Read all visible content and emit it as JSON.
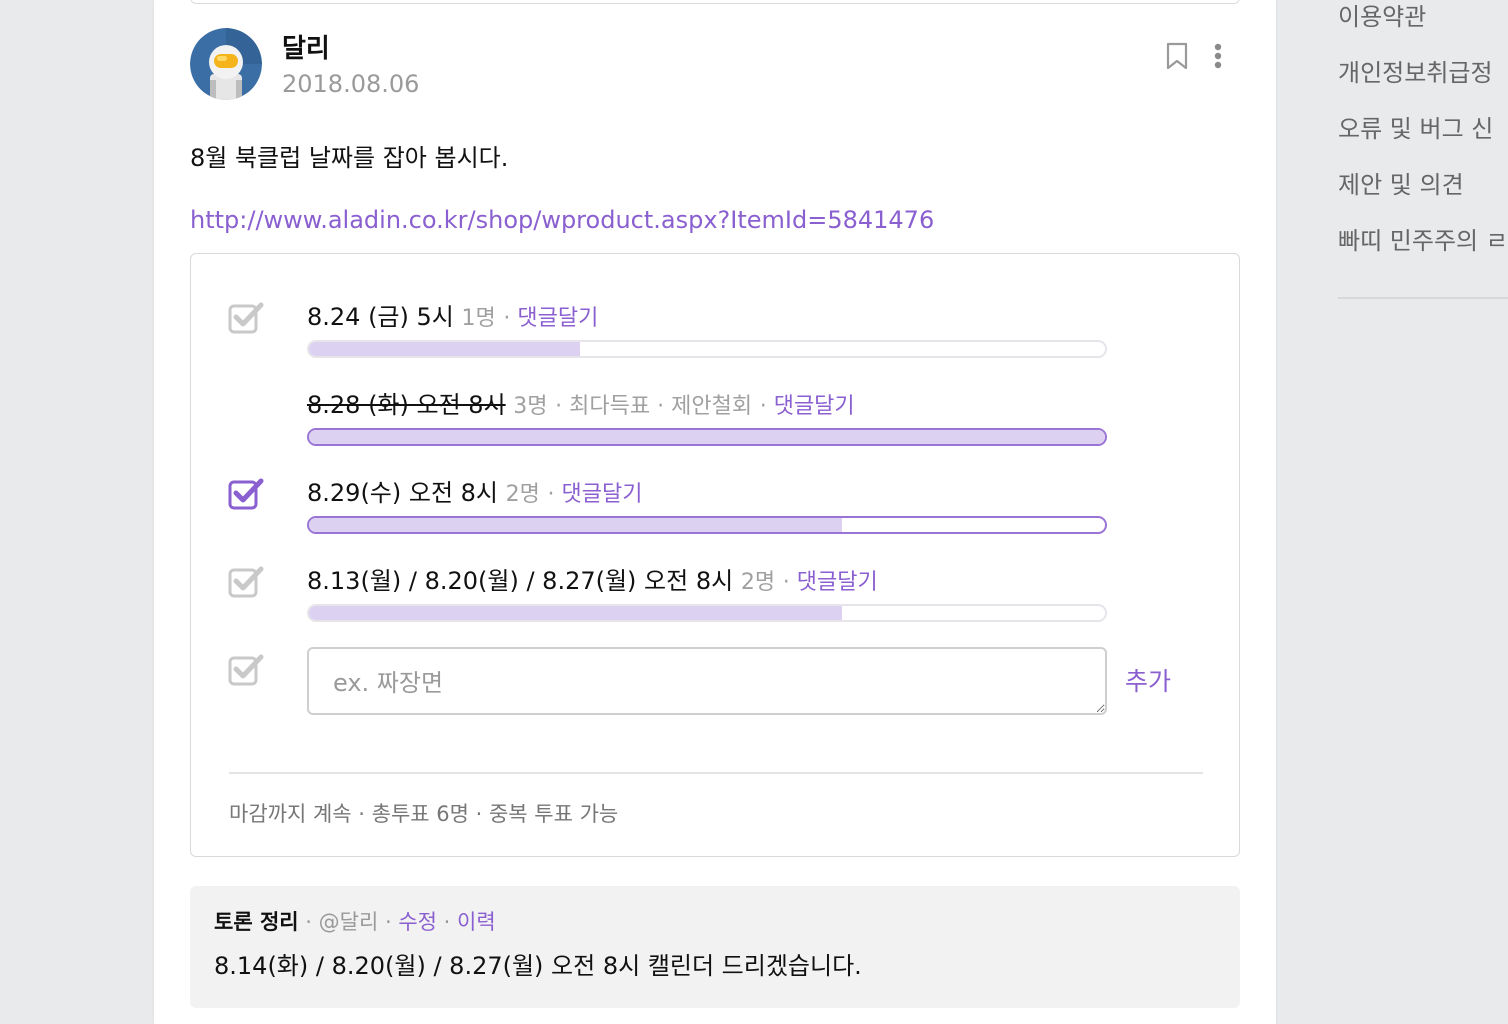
{
  "post": {
    "author": "달리",
    "date": "2018.08.06",
    "body": "8월 북클럽 날짜를 잡아 봅시다.",
    "link": "http://www.aladin.co.kr/shop/wproduct.aspx?ItemId=5841476"
  },
  "poll": {
    "options": [
      {
        "label": "8.24 (금) 5시",
        "votes": "1명",
        "extra": "",
        "reply": "댓글달기",
        "checked": false,
        "progress": 0.34
      },
      {
        "label": "8.28 (화) 오전 8시",
        "votes": "3명",
        "extra": "· 최다득표 · 제안철회",
        "reply": "댓글달기",
        "checked": false,
        "withdrawn": true,
        "progress": 1.0
      },
      {
        "label": "8.29(수) 오전 8시",
        "votes": "2명",
        "extra": "",
        "reply": "댓글달기",
        "checked": true,
        "progress": 0.67
      },
      {
        "label": "8.13(월) / 8.20(월) / 8.27(월) 오전 8시",
        "votes": "2명",
        "extra": "",
        "reply": "댓글달기",
        "checked": false,
        "progress": 0.67
      }
    ],
    "new_option_placeholder": "ex. 짜장면",
    "add_label": "추가",
    "footer": "마감까지 계속 · 총투표 6명 · 중복 투표 가능"
  },
  "summary": {
    "title": "토론 정리",
    "author": "@달리",
    "edit": "수정",
    "history": "이력",
    "text": "8.14(화) / 8.20(월) / 8.27(월) 오전 8시 캘린더 드리겠습니다."
  },
  "sidebar": {
    "links": [
      "이용약관",
      "개인정보취급정",
      "오류 및 버그 신",
      "제안 및 의견",
      "빠띠 민주주의 ㄹ"
    ]
  },
  "colors": {
    "accent": "#8a5fd0",
    "bar_fill": "#ddd1f1",
    "bar_selected_border": "#9b74d6",
    "muted": "#a0a0a0"
  }
}
